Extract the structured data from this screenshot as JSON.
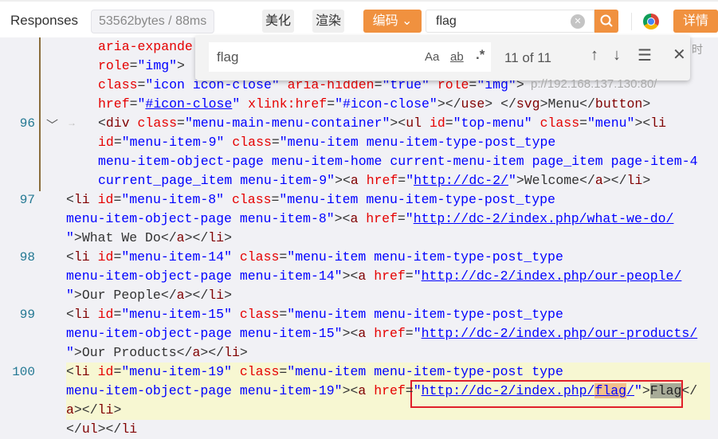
{
  "header": {
    "title": "Responses",
    "meta": "53562bytes / 88ms",
    "beautify": "美化",
    "render": "渲染",
    "encoding": "编码",
    "search_value": "flag",
    "details": "详情",
    "accent": "#f0913f"
  },
  "find": {
    "value": "flag",
    "match_case": "Aa",
    "whole_word": "ab",
    "regex": ".*",
    "count": "11 of 11"
  },
  "overlay_hint": "p://192.168.137.130:80/",
  "side_hint": "时",
  "line_numbers": [
    {
      "n": "96",
      "row": 4
    },
    {
      "n": "97",
      "row": 8
    },
    {
      "n": "98",
      "row": 11
    },
    {
      "n": "99",
      "row": 14
    },
    {
      "n": "100",
      "row": 17
    }
  ],
  "rows": [
    {
      "indent": 1,
      "seg": [
        [
          "a",
          "aria-expande"
        ]
      ]
    },
    {
      "indent": 1,
      "seg": [
        [
          "a",
          "role"
        ],
        [
          "p",
          "="
        ],
        [
          "v",
          "\"img\""
        ],
        [
          "p",
          ">"
        ]
      ]
    },
    {
      "indent": 1,
      "seg": [
        [
          "a",
          "class"
        ],
        [
          "p",
          "="
        ],
        [
          "v",
          "\"icon icon-close\""
        ],
        [
          "p",
          " "
        ],
        [
          "a",
          "aria-hidden"
        ],
        [
          "p",
          "="
        ],
        [
          "v",
          "\"true\""
        ],
        [
          "p",
          " "
        ],
        [
          "a",
          "role"
        ],
        [
          "p",
          "="
        ],
        [
          "v",
          "\"img\""
        ],
        [
          "p",
          "> "
        ]
      ]
    },
    {
      "indent": 1,
      "seg": [
        [
          "a",
          "href"
        ],
        [
          "p",
          "="
        ],
        [
          "v",
          "\""
        ],
        [
          "u",
          "#icon-close"
        ],
        [
          "v",
          "\""
        ],
        [
          "p",
          " "
        ],
        [
          "a",
          "xlink:href"
        ],
        [
          "p",
          "="
        ],
        [
          "v",
          "\"#icon-close\""
        ],
        [
          "p",
          "></"
        ],
        [
          "t",
          "use"
        ],
        [
          "p",
          "> </"
        ],
        [
          "t",
          "svg"
        ],
        [
          "p",
          ">"
        ],
        [
          "x",
          "Menu"
        ],
        [
          "p",
          "</"
        ],
        [
          "t",
          "button"
        ],
        [
          "p",
          ">"
        ]
      ]
    },
    {
      "indent": 1,
      "seg": [
        [
          "p",
          "<"
        ],
        [
          "t",
          "div"
        ],
        [
          "p",
          " "
        ],
        [
          "a",
          "class"
        ],
        [
          "p",
          "="
        ],
        [
          "v",
          "\"menu-main-menu-container\""
        ],
        [
          "p",
          "><"
        ],
        [
          "t",
          "ul"
        ],
        [
          "p",
          " "
        ],
        [
          "a",
          "id"
        ],
        [
          "p",
          "="
        ],
        [
          "v",
          "\"top-menu\""
        ],
        [
          "p",
          " "
        ],
        [
          "a",
          "class"
        ],
        [
          "p",
          "="
        ],
        [
          "v",
          "\"menu\""
        ],
        [
          "p",
          "><"
        ],
        [
          "t",
          "li"
        ]
      ]
    },
    {
      "indent": 1,
      "seg": [
        [
          "a",
          "id"
        ],
        [
          "p",
          "="
        ],
        [
          "v",
          "\"menu-item-9\""
        ],
        [
          "p",
          " "
        ],
        [
          "a",
          "class"
        ],
        [
          "p",
          "="
        ],
        [
          "v",
          "\"menu-item menu-item-type-post_type"
        ]
      ]
    },
    {
      "indent": 1,
      "seg": [
        [
          "v",
          "menu-item-object-page menu-item-home current-menu-item page_item page-item-4"
        ]
      ]
    },
    {
      "indent": 1,
      "seg": [
        [
          "v",
          "current_page_item menu-item-9\""
        ],
        [
          "p",
          "><"
        ],
        [
          "t",
          "a"
        ],
        [
          "p",
          " "
        ],
        [
          "a",
          "href"
        ],
        [
          "p",
          "="
        ],
        [
          "v",
          "\""
        ],
        [
          "u",
          "http://dc-2/"
        ],
        [
          "v",
          "\""
        ],
        [
          "p",
          ">"
        ],
        [
          "x",
          "Welcome"
        ],
        [
          "p",
          "</"
        ],
        [
          "t",
          "a"
        ],
        [
          "p",
          "></"
        ],
        [
          "t",
          "li"
        ],
        [
          "p",
          ">"
        ]
      ]
    },
    {
      "indent": 0,
      "seg": [
        [
          "p",
          "<"
        ],
        [
          "t",
          "li"
        ],
        [
          "p",
          " "
        ],
        [
          "a",
          "id"
        ],
        [
          "p",
          "="
        ],
        [
          "v",
          "\"menu-item-8\""
        ],
        [
          "p",
          " "
        ],
        [
          "a",
          "class"
        ],
        [
          "p",
          "="
        ],
        [
          "v",
          "\"menu-item menu-item-type-post_type"
        ]
      ]
    },
    {
      "indent": 0,
      "seg": [
        [
          "v",
          "menu-item-object-page menu-item-8\""
        ],
        [
          "p",
          "><"
        ],
        [
          "t",
          "a"
        ],
        [
          "p",
          " "
        ],
        [
          "a",
          "href"
        ],
        [
          "p",
          "="
        ],
        [
          "v",
          "\""
        ],
        [
          "u",
          "http://dc-2/index.php/what-we-do/"
        ]
      ]
    },
    {
      "indent": 0,
      "seg": [
        [
          "v",
          "\""
        ],
        [
          "p",
          ">"
        ],
        [
          "x",
          "What We Do"
        ],
        [
          "p",
          "</"
        ],
        [
          "t",
          "a"
        ],
        [
          "p",
          "></"
        ],
        [
          "t",
          "li"
        ],
        [
          "p",
          ">"
        ]
      ]
    },
    {
      "indent": 0,
      "seg": [
        [
          "p",
          "<"
        ],
        [
          "t",
          "li"
        ],
        [
          "p",
          " "
        ],
        [
          "a",
          "id"
        ],
        [
          "p",
          "="
        ],
        [
          "v",
          "\"menu-item-14\""
        ],
        [
          "p",
          " "
        ],
        [
          "a",
          "class"
        ],
        [
          "p",
          "="
        ],
        [
          "v",
          "\"menu-item menu-item-type-post_type"
        ]
      ]
    },
    {
      "indent": 0,
      "seg": [
        [
          "v",
          "menu-item-object-page menu-item-14\""
        ],
        [
          "p",
          "><"
        ],
        [
          "t",
          "a"
        ],
        [
          "p",
          " "
        ],
        [
          "a",
          "href"
        ],
        [
          "p",
          "="
        ],
        [
          "v",
          "\""
        ],
        [
          "u",
          "http://dc-2/index.php/our-people/"
        ]
      ]
    },
    {
      "indent": 0,
      "seg": [
        [
          "v",
          "\""
        ],
        [
          "p",
          ">"
        ],
        [
          "x",
          "Our People"
        ],
        [
          "p",
          "</"
        ],
        [
          "t",
          "a"
        ],
        [
          "p",
          "></"
        ],
        [
          "t",
          "li"
        ],
        [
          "p",
          ">"
        ]
      ]
    },
    {
      "indent": 0,
      "seg": [
        [
          "p",
          "<"
        ],
        [
          "t",
          "li"
        ],
        [
          "p",
          " "
        ],
        [
          "a",
          "id"
        ],
        [
          "p",
          "="
        ],
        [
          "v",
          "\"menu-item-15\""
        ],
        [
          "p",
          " "
        ],
        [
          "a",
          "class"
        ],
        [
          "p",
          "="
        ],
        [
          "v",
          "\"menu-item menu-item-type-post_type"
        ]
      ]
    },
    {
      "indent": 0,
      "seg": [
        [
          "v",
          "menu-item-object-page menu-item-15\""
        ],
        [
          "p",
          "><"
        ],
        [
          "t",
          "a"
        ],
        [
          "p",
          " "
        ],
        [
          "a",
          "href"
        ],
        [
          "p",
          "="
        ],
        [
          "v",
          "\""
        ],
        [
          "u",
          "http://dc-2/index.php/our-products/"
        ]
      ]
    },
    {
      "indent": 0,
      "seg": [
        [
          "v",
          "\""
        ],
        [
          "p",
          ">"
        ],
        [
          "x",
          "Our Products"
        ],
        [
          "p",
          "</"
        ],
        [
          "t",
          "a"
        ],
        [
          "p",
          "></"
        ],
        [
          "t",
          "li"
        ],
        [
          "p",
          ">"
        ]
      ]
    },
    {
      "indent": 0,
      "seg": [
        [
          "p",
          "<"
        ],
        [
          "t",
          "li"
        ],
        [
          "p",
          " "
        ],
        [
          "a",
          "id"
        ],
        [
          "p",
          "="
        ],
        [
          "v",
          "\"menu-item-19\""
        ],
        [
          "p",
          " "
        ],
        [
          "a",
          "class"
        ],
        [
          "p",
          "="
        ],
        [
          "v",
          "\"menu-item menu-item-type-post type"
        ]
      ]
    },
    {
      "indent": 0,
      "seg": [
        [
          "v",
          "menu-item-object-page menu-item-19\""
        ],
        [
          "p",
          "><"
        ],
        [
          "t",
          "a"
        ],
        [
          "p",
          " "
        ],
        [
          "a",
          "href"
        ],
        [
          "p",
          "="
        ],
        [
          "v",
          "\""
        ],
        [
          "u",
          "http://dc-2/index.php/"
        ],
        [
          "h",
          "flag"
        ],
        [
          "u",
          "/"
        ],
        [
          "v",
          "\""
        ],
        [
          "p",
          ">"
        ],
        [
          "g",
          "Flag"
        ],
        [
          "p",
          "</"
        ]
      ]
    },
    {
      "indent": 0,
      "seg": [
        [
          "t",
          "a"
        ],
        [
          "p",
          "></"
        ],
        [
          "t",
          "li"
        ],
        [
          "p",
          ">"
        ]
      ]
    },
    {
      "indent": 0,
      "seg": [
        [
          "p",
          "</"
        ],
        [
          "t",
          "ul"
        ],
        [
          "p",
          "></"
        ],
        [
          "t",
          "li"
        ]
      ]
    }
  ]
}
